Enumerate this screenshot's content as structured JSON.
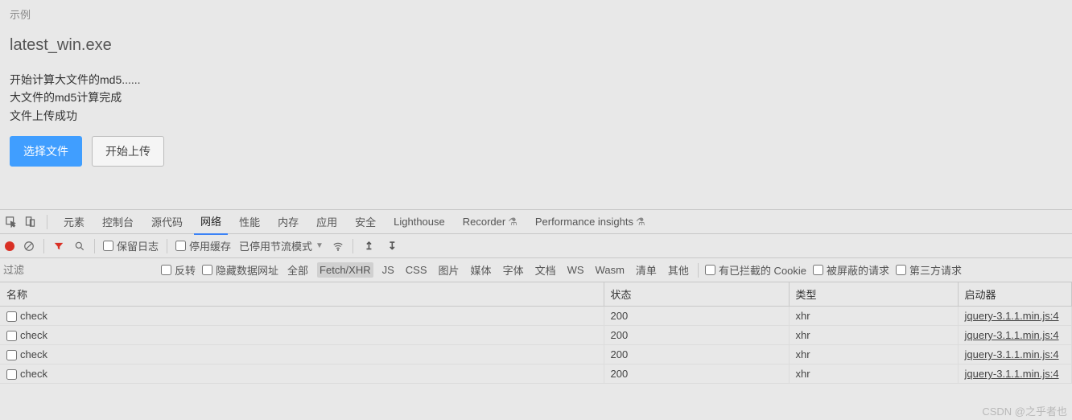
{
  "page": {
    "example_label": "示例",
    "filename": "latest_win.exe",
    "log": [
      "开始计算大文件的md5......",
      "大文件的md5计算完成",
      "文件上传成功"
    ],
    "select_btn": "选择文件",
    "upload_btn": "开始上传"
  },
  "devtools": {
    "tabs": [
      "元素",
      "控制台",
      "源代码",
      "网络",
      "性能",
      "内存",
      "应用",
      "安全",
      "Lighthouse",
      "Recorder",
      "Performance insights"
    ],
    "active_tab": "网络",
    "toolbar": {
      "preserve_log": "保留日志",
      "disable_cache": "停用缓存",
      "throttling": "已停用节流模式"
    },
    "filterbar": {
      "placeholder": "过滤",
      "invert": "反转",
      "hide_data_urls": "隐藏数据网址",
      "types": [
        "全部",
        "Fetch/XHR",
        "JS",
        "CSS",
        "图片",
        "媒体",
        "字体",
        "文档",
        "WS",
        "Wasm",
        "清单",
        "其他"
      ],
      "active_type": "Fetch/XHR",
      "has_blocked_cookies": "有已拦截的 Cookie",
      "blocked_requests": "被屏蔽的请求",
      "third_party": "第三方请求"
    },
    "table": {
      "headers": {
        "name": "名称",
        "status": "状态",
        "type": "类型",
        "initiator": "启动器"
      },
      "rows": [
        {
          "name": "check",
          "status": "200",
          "type": "xhr",
          "initiator": "jquery-3.1.1.min.js:4"
        },
        {
          "name": "check",
          "status": "200",
          "type": "xhr",
          "initiator": "jquery-3.1.1.min.js:4"
        },
        {
          "name": "check",
          "status": "200",
          "type": "xhr",
          "initiator": "jquery-3.1.1.min.js:4"
        },
        {
          "name": "check",
          "status": "200",
          "type": "xhr",
          "initiator": "jquery-3.1.1.min.js:4"
        }
      ]
    }
  },
  "watermark": "CSDN @之乎者也"
}
